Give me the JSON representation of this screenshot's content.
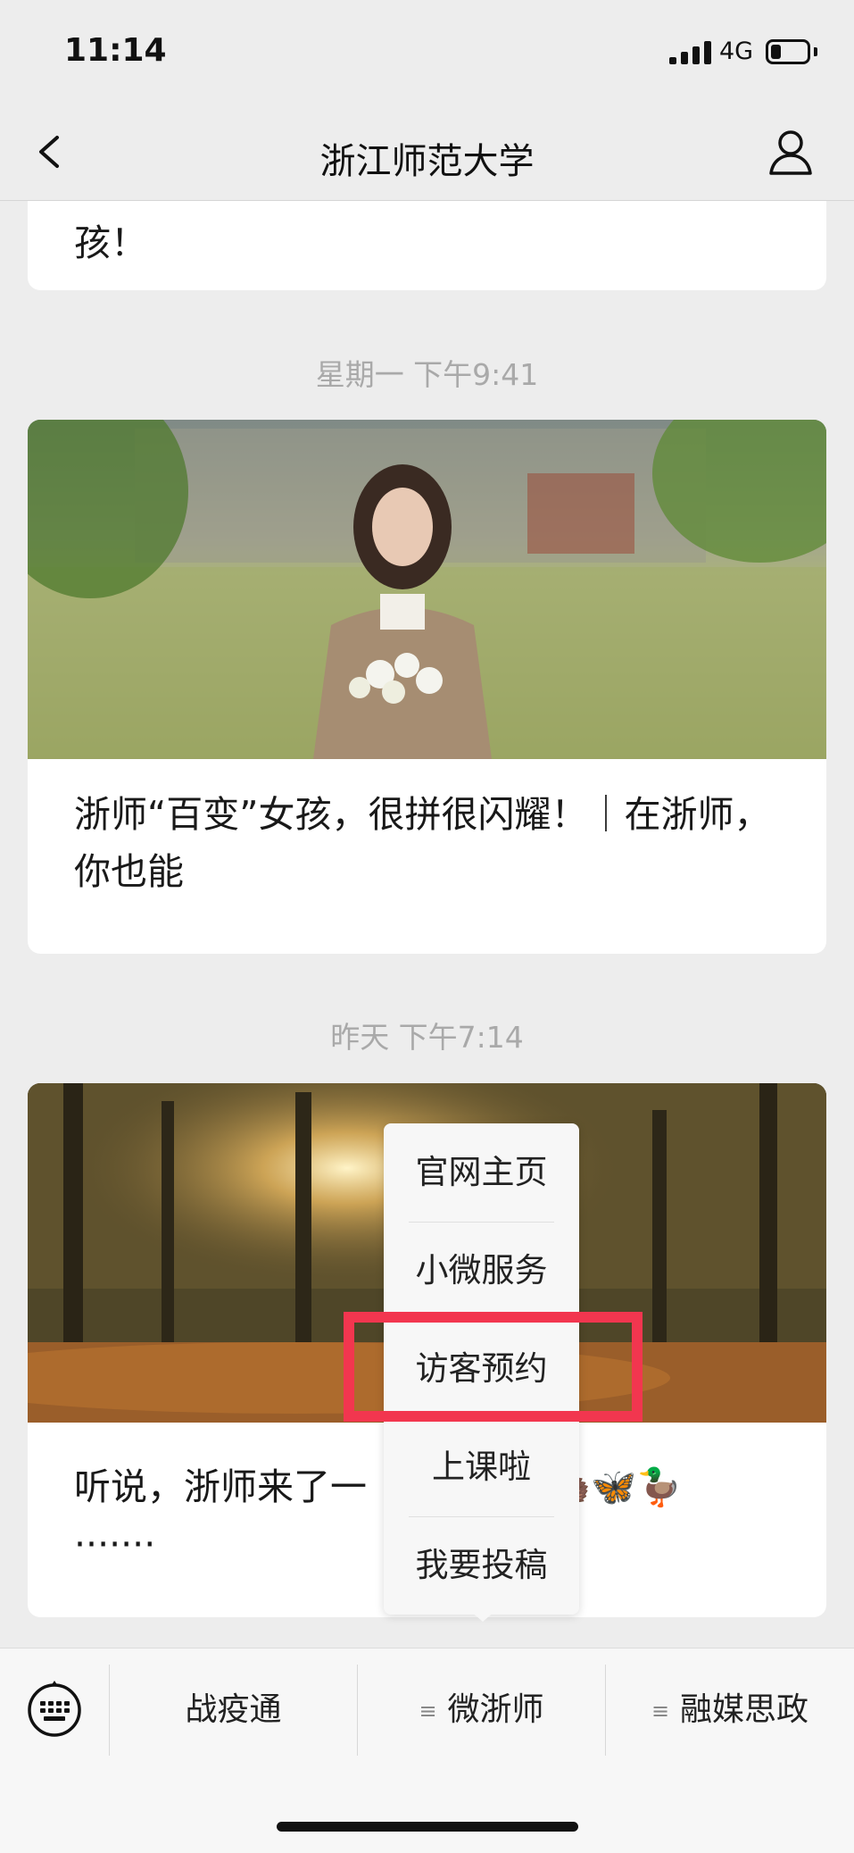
{
  "status_bar": {
    "time": "11:14",
    "network": "4G",
    "battery_level": 0.3
  },
  "nav": {
    "title": "浙江师范大学",
    "back_icon": "chevron-left-icon",
    "profile_icon": "person-icon"
  },
  "feed": {
    "top_card_tail": "孩！",
    "timestamp_1": "星期一 下午9:41",
    "article_1_title": "浙师“百变”女孩，很拼很闪耀！｜在浙师，你也能",
    "timestamp_2": "昨天 下午7:14",
    "article_2_title_start": "听说，浙师来了一",
    "article_2_emoji": "🦔🦋🦆",
    "article_2_ellipsis": "·······"
  },
  "popup_menu": {
    "items": [
      "官网主页",
      "小微服务",
      "访客预约",
      "上课啦",
      "我要投稿"
    ],
    "highlighted": "访客预约",
    "highlight_color": "#f2364f"
  },
  "bottom_menu": {
    "keyboard_icon": "keyboard-icon",
    "items": [
      {
        "label": "战疫通",
        "has_submenu": false
      },
      {
        "label": "微浙师",
        "has_submenu": true
      },
      {
        "label": "融媒思政",
        "has_submenu": true
      }
    ]
  }
}
